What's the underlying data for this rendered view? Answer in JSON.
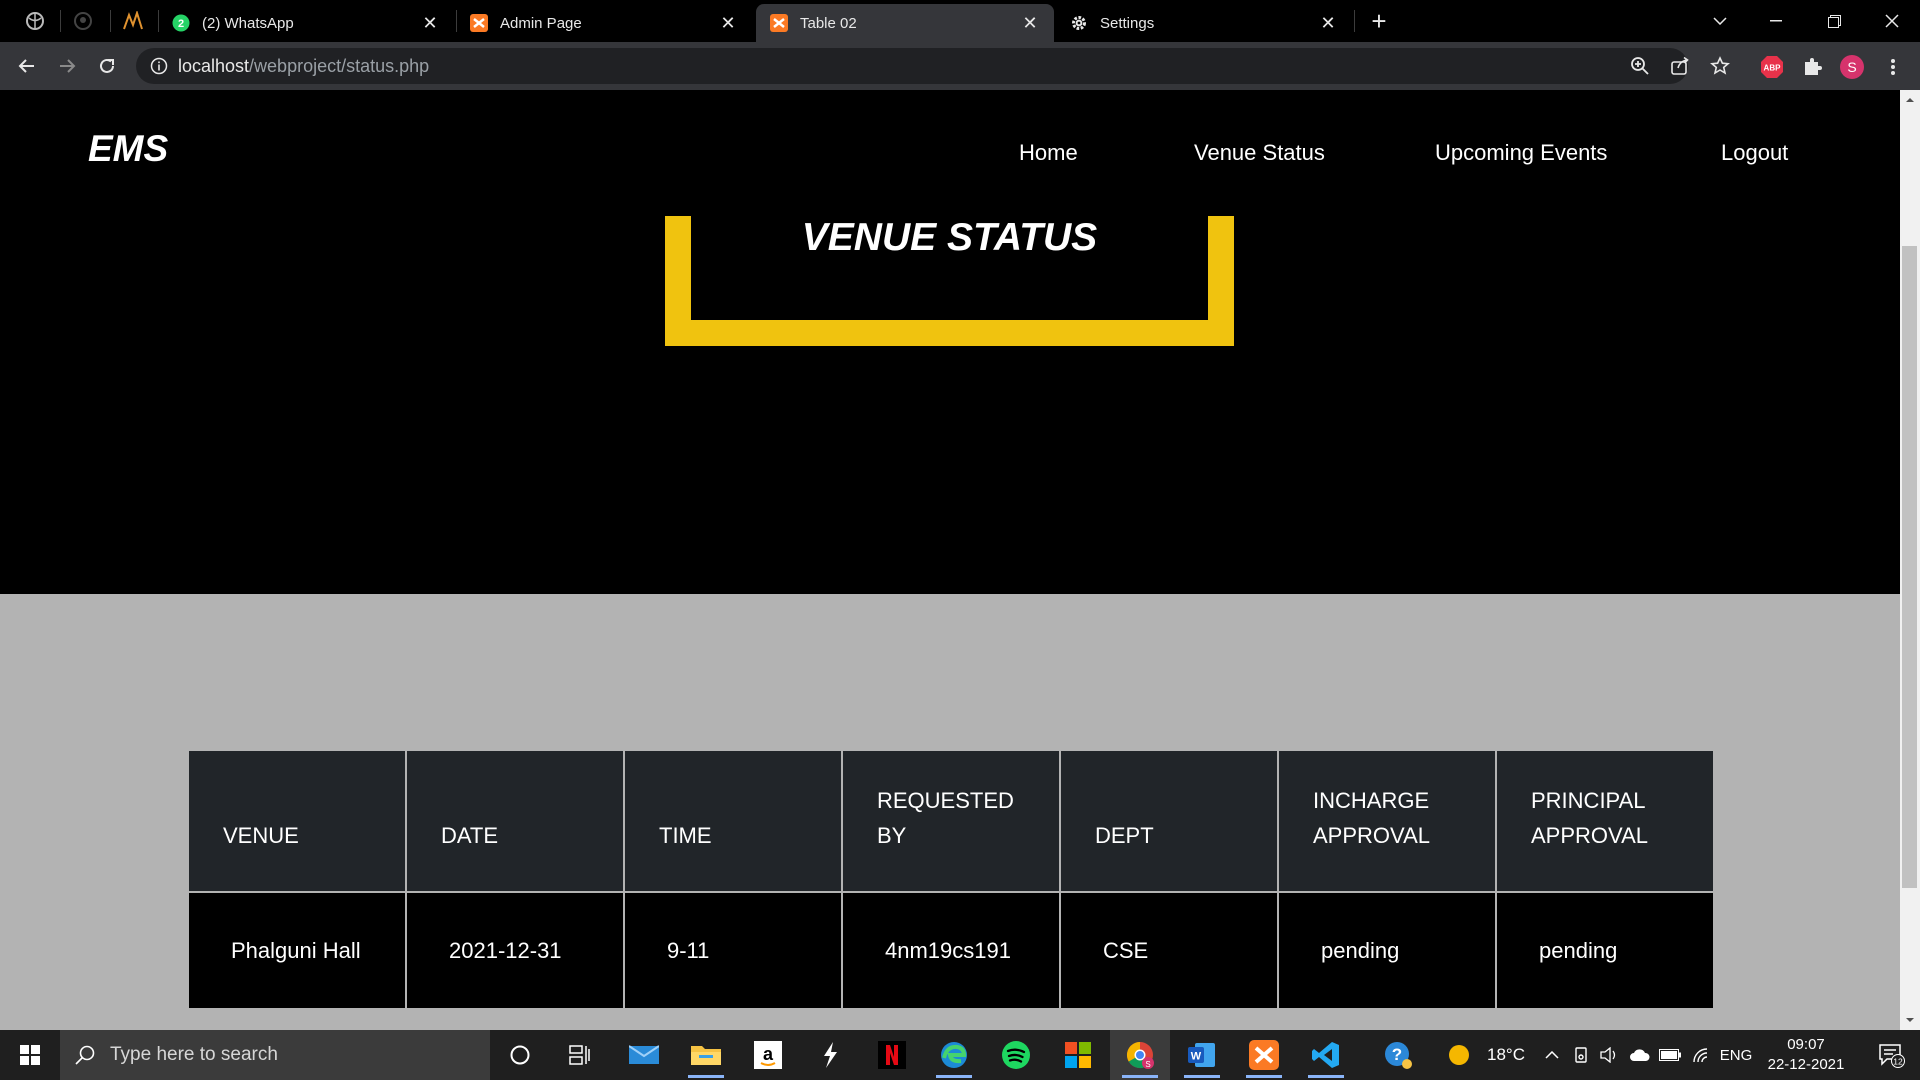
{
  "browser": {
    "tabs": [
      {
        "title": "(2) WhatsApp",
        "icon": "whatsapp-icon"
      },
      {
        "title": "Admin Page",
        "icon": "xampp-icon"
      },
      {
        "title": "Table 02",
        "icon": "xampp-icon",
        "active": true
      },
      {
        "title": "Settings",
        "icon": "gear-icon"
      }
    ],
    "url_host": "localhost",
    "url_path": "/webproject/status.php",
    "profile_initial": "S",
    "adblock_label": "ABP"
  },
  "site": {
    "logo": "EMS",
    "nav": [
      "Home",
      "Venue Status",
      "Upcoming Events",
      "Logout"
    ],
    "hero_title": "VENUE STATUS",
    "accent_color": "#f0c30f"
  },
  "table": {
    "headers": [
      "VENUE",
      "DATE",
      "TIME",
      "REQUESTED BY",
      "DEPT",
      "INCHARGE APPROVAL",
      "PRINCIPAL APPROVAL"
    ],
    "rows": [
      [
        "Phalguni Hall",
        "2021-12-31",
        "9-11",
        "4nm19cs191",
        "CSE",
        "pending",
        "pending"
      ]
    ]
  },
  "taskbar": {
    "search_placeholder": "Type here to search",
    "temperature": "18°C",
    "language": "ENG",
    "time": "09:07",
    "date": "22-12-2021",
    "notification_count": "12"
  }
}
